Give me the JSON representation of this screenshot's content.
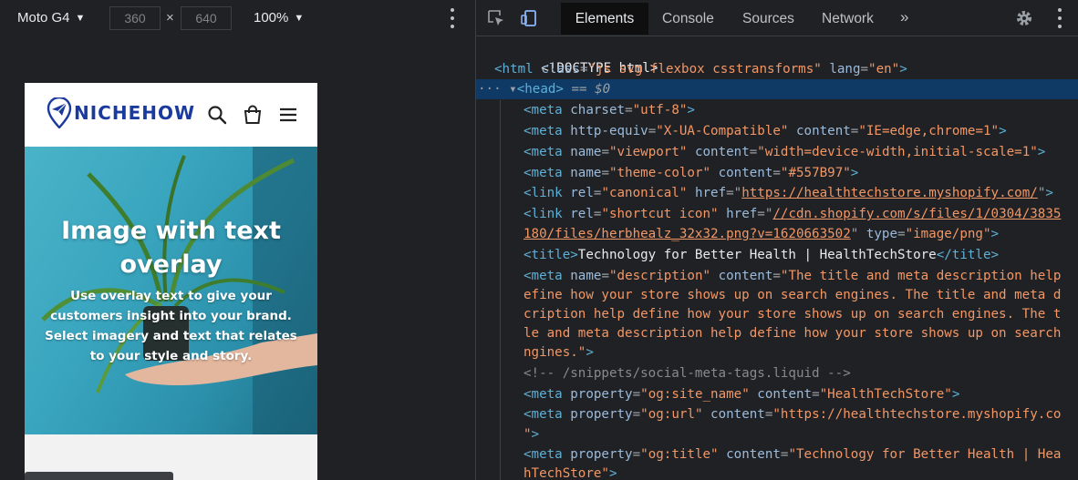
{
  "device_toolbar": {
    "device_name": "Moto G4",
    "width": "360",
    "height": "640",
    "times_symbol": "×",
    "zoom": "100%"
  },
  "site": {
    "logo_text": "NICHEHOW",
    "hero_title": "Image with text overlay",
    "hero_text": "Use overlay text to give your customers insight into your brand. Select imagery and text that relates to your style and story."
  },
  "devtools": {
    "tabs": [
      "Elements",
      "Console",
      "Sources",
      "Network"
    ],
    "more_tabs": "»",
    "selected_marker": "== $0",
    "row_dots": "···",
    "dom": {
      "l1": "<!DOCTYPE html>",
      "l2_tag_open": "<html",
      "l2_attr1": "class",
      "l2_val1": "\"js svg flexbox csstransforms\"",
      "l2_attr2": "lang",
      "l2_val2": "\"en\"",
      "l2_tag_close": ">",
      "l3": "<head>",
      "l4_tag": "<meta",
      "l4_attr": "charset",
      "l4_val": "\"utf-8\"",
      "l5_attr1": "http-equiv",
      "l5_val1": "\"X-UA-Compatible\"",
      "l5_attr2": "content",
      "l5_val2": "\"IE=edge,chrome=1\"",
      "l6_attr1": "name",
      "l6_val1": "\"viewport\"",
      "l6_attr2": "content",
      "l6_val2": "\"width=device-width,initial-scale=1\"",
      "l7_attr1": "name",
      "l7_val1": "\"theme-color\"",
      "l7_attr2": "content",
      "l7_val2": "\"#557B97\"",
      "l8_tag": "<link",
      "l8_attr1": "rel",
      "l8_val1": "\"canonical\"",
      "l8_attr2": "href",
      "l8_val2": "https://healthtechstore.myshopify.com/",
      "l9_attr1": "rel",
      "l9_val1": "\"shortcut icon\"",
      "l9_attr2": "href",
      "l9_val2a": "//cdn.shopify.com/s/files/1/0304/3835",
      "l10_val2b": "180/files/herbhealz_32x32.png?v=1620663502",
      "l10_attr3": "type",
      "l10_val3": "\"image/png\"",
      "l11_open": "<title>",
      "l11_text": "Technology for Better Health | HealthTechStore",
      "l11_close": "</title>",
      "l12_attr1": "name",
      "l12_val1": "\"description\"",
      "l12_attr2": "content",
      "l12_val2": "\"The title and meta description help",
      "l13": "efine how your store shows up on search engines. The title and meta d",
      "l14": "cription help define how your store shows up on search engines. The t",
      "l15": "le and meta description help define how your store shows up on search",
      "l16": "ngines.\"",
      "l17": "<!-- /snippets/social-meta-tags.liquid -->",
      "l18_attr1": "property",
      "l18_val1": "\"og:site_name\"",
      "l18_attr2": "content",
      "l18_val2": "\"HealthTechStore\"",
      "l19_attr1": "property",
      "l19_val1": "\"og:url\"",
      "l19_attr2": "content",
      "l19_val2": "\"https://healthtechstore.myshopify.co",
      "l20": "\"",
      "l21_attr1": "property",
      "l21_val1": "\"og:title\"",
      "l21_attr2": "content",
      "l21_val2": "\"Technology for Better Health | Hea",
      "l22": "hTechStore\""
    }
  },
  "colors": {
    "devtools_bg": "#202124",
    "selected_row": "#0f3a66",
    "tag": "#5db0d7",
    "attribute": "#9bbbdc",
    "value": "#f29766",
    "logo_blue": "#1a3a9e"
  }
}
